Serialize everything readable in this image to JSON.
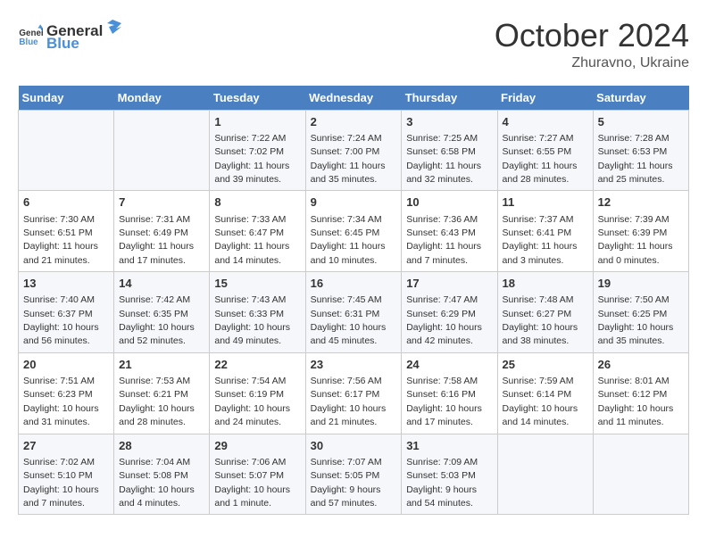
{
  "logo": {
    "text_general": "General",
    "text_blue": "Blue"
  },
  "header": {
    "month": "October 2024",
    "location": "Zhuravno, Ukraine"
  },
  "weekdays": [
    "Sunday",
    "Monday",
    "Tuesday",
    "Wednesday",
    "Thursday",
    "Friday",
    "Saturday"
  ],
  "weeks": [
    [
      {
        "day": "",
        "sunrise": "",
        "sunset": "",
        "daylight": ""
      },
      {
        "day": "",
        "sunrise": "",
        "sunset": "",
        "daylight": ""
      },
      {
        "day": "1",
        "sunrise": "Sunrise: 7:22 AM",
        "sunset": "Sunset: 7:02 PM",
        "daylight": "Daylight: 11 hours and 39 minutes."
      },
      {
        "day": "2",
        "sunrise": "Sunrise: 7:24 AM",
        "sunset": "Sunset: 7:00 PM",
        "daylight": "Daylight: 11 hours and 35 minutes."
      },
      {
        "day": "3",
        "sunrise": "Sunrise: 7:25 AM",
        "sunset": "Sunset: 6:58 PM",
        "daylight": "Daylight: 11 hours and 32 minutes."
      },
      {
        "day": "4",
        "sunrise": "Sunrise: 7:27 AM",
        "sunset": "Sunset: 6:55 PM",
        "daylight": "Daylight: 11 hours and 28 minutes."
      },
      {
        "day": "5",
        "sunrise": "Sunrise: 7:28 AM",
        "sunset": "Sunset: 6:53 PM",
        "daylight": "Daylight: 11 hours and 25 minutes."
      }
    ],
    [
      {
        "day": "6",
        "sunrise": "Sunrise: 7:30 AM",
        "sunset": "Sunset: 6:51 PM",
        "daylight": "Daylight: 11 hours and 21 minutes."
      },
      {
        "day": "7",
        "sunrise": "Sunrise: 7:31 AM",
        "sunset": "Sunset: 6:49 PM",
        "daylight": "Daylight: 11 hours and 17 minutes."
      },
      {
        "day": "8",
        "sunrise": "Sunrise: 7:33 AM",
        "sunset": "Sunset: 6:47 PM",
        "daylight": "Daylight: 11 hours and 14 minutes."
      },
      {
        "day": "9",
        "sunrise": "Sunrise: 7:34 AM",
        "sunset": "Sunset: 6:45 PM",
        "daylight": "Daylight: 11 hours and 10 minutes."
      },
      {
        "day": "10",
        "sunrise": "Sunrise: 7:36 AM",
        "sunset": "Sunset: 6:43 PM",
        "daylight": "Daylight: 11 hours and 7 minutes."
      },
      {
        "day": "11",
        "sunrise": "Sunrise: 7:37 AM",
        "sunset": "Sunset: 6:41 PM",
        "daylight": "Daylight: 11 hours and 3 minutes."
      },
      {
        "day": "12",
        "sunrise": "Sunrise: 7:39 AM",
        "sunset": "Sunset: 6:39 PM",
        "daylight": "Daylight: 11 hours and 0 minutes."
      }
    ],
    [
      {
        "day": "13",
        "sunrise": "Sunrise: 7:40 AM",
        "sunset": "Sunset: 6:37 PM",
        "daylight": "Daylight: 10 hours and 56 minutes."
      },
      {
        "day": "14",
        "sunrise": "Sunrise: 7:42 AM",
        "sunset": "Sunset: 6:35 PM",
        "daylight": "Daylight: 10 hours and 52 minutes."
      },
      {
        "day": "15",
        "sunrise": "Sunrise: 7:43 AM",
        "sunset": "Sunset: 6:33 PM",
        "daylight": "Daylight: 10 hours and 49 minutes."
      },
      {
        "day": "16",
        "sunrise": "Sunrise: 7:45 AM",
        "sunset": "Sunset: 6:31 PM",
        "daylight": "Daylight: 10 hours and 45 minutes."
      },
      {
        "day": "17",
        "sunrise": "Sunrise: 7:47 AM",
        "sunset": "Sunset: 6:29 PM",
        "daylight": "Daylight: 10 hours and 42 minutes."
      },
      {
        "day": "18",
        "sunrise": "Sunrise: 7:48 AM",
        "sunset": "Sunset: 6:27 PM",
        "daylight": "Daylight: 10 hours and 38 minutes."
      },
      {
        "day": "19",
        "sunrise": "Sunrise: 7:50 AM",
        "sunset": "Sunset: 6:25 PM",
        "daylight": "Daylight: 10 hours and 35 minutes."
      }
    ],
    [
      {
        "day": "20",
        "sunrise": "Sunrise: 7:51 AM",
        "sunset": "Sunset: 6:23 PM",
        "daylight": "Daylight: 10 hours and 31 minutes."
      },
      {
        "day": "21",
        "sunrise": "Sunrise: 7:53 AM",
        "sunset": "Sunset: 6:21 PM",
        "daylight": "Daylight: 10 hours and 28 minutes."
      },
      {
        "day": "22",
        "sunrise": "Sunrise: 7:54 AM",
        "sunset": "Sunset: 6:19 PM",
        "daylight": "Daylight: 10 hours and 24 minutes."
      },
      {
        "day": "23",
        "sunrise": "Sunrise: 7:56 AM",
        "sunset": "Sunset: 6:17 PM",
        "daylight": "Daylight: 10 hours and 21 minutes."
      },
      {
        "day": "24",
        "sunrise": "Sunrise: 7:58 AM",
        "sunset": "Sunset: 6:16 PM",
        "daylight": "Daylight: 10 hours and 17 minutes."
      },
      {
        "day": "25",
        "sunrise": "Sunrise: 7:59 AM",
        "sunset": "Sunset: 6:14 PM",
        "daylight": "Daylight: 10 hours and 14 minutes."
      },
      {
        "day": "26",
        "sunrise": "Sunrise: 8:01 AM",
        "sunset": "Sunset: 6:12 PM",
        "daylight": "Daylight: 10 hours and 11 minutes."
      }
    ],
    [
      {
        "day": "27",
        "sunrise": "Sunrise: 7:02 AM",
        "sunset": "Sunset: 5:10 PM",
        "daylight": "Daylight: 10 hours and 7 minutes."
      },
      {
        "day": "28",
        "sunrise": "Sunrise: 7:04 AM",
        "sunset": "Sunset: 5:08 PM",
        "daylight": "Daylight: 10 hours and 4 minutes."
      },
      {
        "day": "29",
        "sunrise": "Sunrise: 7:06 AM",
        "sunset": "Sunset: 5:07 PM",
        "daylight": "Daylight: 10 hours and 1 minute."
      },
      {
        "day": "30",
        "sunrise": "Sunrise: 7:07 AM",
        "sunset": "Sunset: 5:05 PM",
        "daylight": "Daylight: 9 hours and 57 minutes."
      },
      {
        "day": "31",
        "sunrise": "Sunrise: 7:09 AM",
        "sunset": "Sunset: 5:03 PM",
        "daylight": "Daylight: 9 hours and 54 minutes."
      },
      {
        "day": "",
        "sunrise": "",
        "sunset": "",
        "daylight": ""
      },
      {
        "day": "",
        "sunrise": "",
        "sunset": "",
        "daylight": ""
      }
    ]
  ]
}
